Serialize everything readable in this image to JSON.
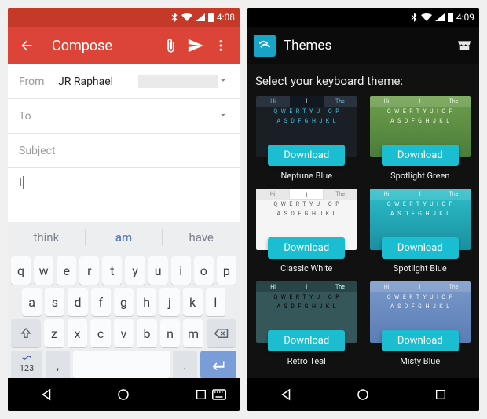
{
  "left": {
    "statusbar": {
      "time": "4:08"
    },
    "appbar": {
      "title": "Compose"
    },
    "from_label": "From",
    "from_value": "JR Raphael",
    "to_label": "To",
    "subject_label": "Subject",
    "body_text": "I",
    "suggestions": {
      "left": "think",
      "mid": "am",
      "right": "have"
    },
    "keys": {
      "row1": [
        "q",
        "w",
        "e",
        "r",
        "t",
        "y",
        "u",
        "i",
        "o",
        "p"
      ],
      "row2": [
        "a",
        "s",
        "d",
        "f",
        "g",
        "h",
        "j",
        "k",
        "l"
      ],
      "row3": [
        "z",
        "x",
        "c",
        "v",
        "b",
        "n",
        "m"
      ],
      "numkey": "123",
      "comma": ",",
      "period": "."
    }
  },
  "right": {
    "statusbar": {
      "time": "4:09"
    },
    "appbar": {
      "title": "Themes"
    },
    "heading": "Select your keyboard theme:",
    "download_label": "Download",
    "sug_labels": {
      "l": "Hi",
      "m": "I",
      "r": "The"
    },
    "kb_rows": {
      "r1": "QWERTYUIOP",
      "r2": "ASDFGHJKL"
    },
    "themes": [
      {
        "name": "Neptune Blue"
      },
      {
        "name": "Spotlight Green"
      },
      {
        "name": "Classic White"
      },
      {
        "name": "Spotlight Blue"
      },
      {
        "name": "Retro Teal"
      },
      {
        "name": "Misty Blue"
      }
    ]
  }
}
